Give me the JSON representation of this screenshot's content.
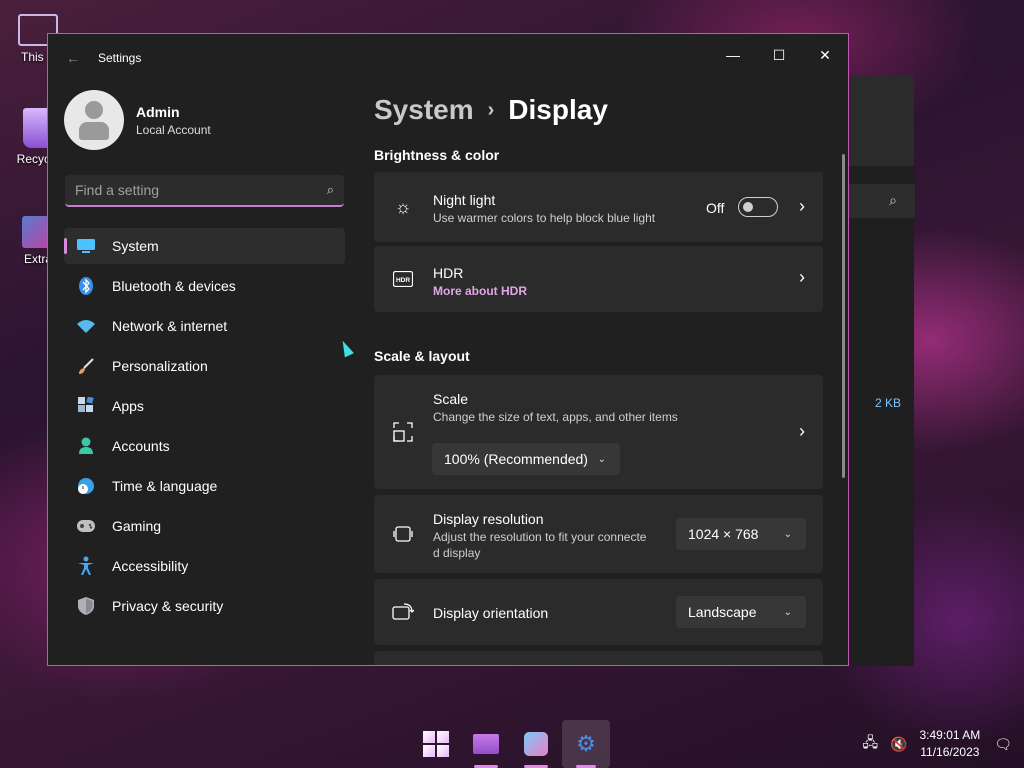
{
  "desktop": {
    "icons": [
      {
        "label": "This P",
        "icon": "this-pc-icon"
      },
      {
        "label": "Recycle",
        "icon": "recycle-bin-icon"
      },
      {
        "label": "Extra",
        "icon": "game-shortcut-icon"
      }
    ]
  },
  "background_window": {
    "search_icon": "⌕",
    "file_size": "2 KB"
  },
  "window": {
    "title": "Settings",
    "back": "←",
    "minimize": "—",
    "maximize": "☐",
    "close": "✕"
  },
  "profile": {
    "name": "Admin",
    "account_type": "Local Account"
  },
  "search": {
    "placeholder": "Find a setting",
    "icon": "⌕"
  },
  "nav": [
    {
      "label": "System",
      "icon": "system-icon",
      "color": "#4cc2ff",
      "active": true
    },
    {
      "label": "Bluetooth & devices",
      "icon": "bluetooth-icon",
      "color": "#3a8fe8"
    },
    {
      "label": "Network & internet",
      "icon": "wifi-icon",
      "color": "#58b8f0"
    },
    {
      "label": "Personalization",
      "icon": "brush-icon",
      "color": "#e8a060"
    },
    {
      "label": "Apps",
      "icon": "apps-icon",
      "color": "#9fb8d8"
    },
    {
      "label": "Accounts",
      "icon": "accounts-icon",
      "color": "#3ac8a8"
    },
    {
      "label": "Time & language",
      "icon": "globe-clock-icon",
      "color": "#3aa0e8"
    },
    {
      "label": "Gaming",
      "icon": "gamepad-icon",
      "color": "#c0c0c0"
    },
    {
      "label": "Accessibility",
      "icon": "accessibility-icon",
      "color": "#4aa8f0"
    },
    {
      "label": "Privacy & security",
      "icon": "shield-icon",
      "color": "#b0b0b8"
    }
  ],
  "breadcrumb": {
    "parent": "System",
    "separator": "›",
    "current": "Display"
  },
  "sections": {
    "brightness": "Brightness & color",
    "scale_layout": "Scale & layout"
  },
  "cards": {
    "night_light": {
      "title": "Night light",
      "subtitle": "Use warmer colors to help block blue light",
      "state": "Off",
      "icon": "☼"
    },
    "hdr": {
      "title": "HDR",
      "link": "More about HDR",
      "icon": "HDR"
    },
    "scale": {
      "title": "Scale",
      "subtitle": "Change the size of text, apps, and other items",
      "value": "100% (Recommended)"
    },
    "resolution": {
      "title": "Display resolution",
      "subtitle_line1": "Adjust the resolution to fit your connecte",
      "subtitle_line2": "d display",
      "value": "1024 × 768"
    },
    "orientation": {
      "title": "Display orientation",
      "value": "Landscape"
    }
  },
  "glyphs": {
    "chevron_right": "›",
    "chevron_down": "⌄"
  },
  "taskbar": {
    "time": "3:49:01 AM",
    "date": "11/16/2023",
    "tray_network": "🖧",
    "tray_volume": "🔇",
    "tray_notification": "🗨"
  },
  "colors": {
    "accent": "#d78bdc",
    "window_border": "#c456b8",
    "link": "#e2a6e6"
  }
}
